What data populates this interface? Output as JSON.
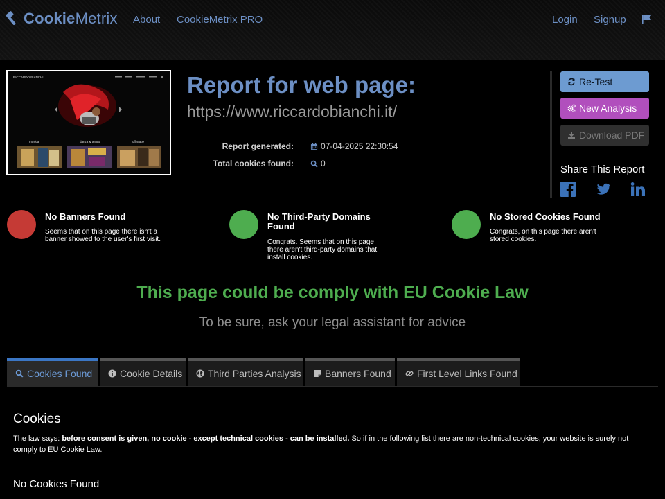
{
  "nav": {
    "brand_bold": "Cookie",
    "brand_rest": "Metrix",
    "about": "About",
    "pro": "CookieMetrix PRO",
    "login": "Login",
    "signup": "Signup"
  },
  "report": {
    "title": "Report for web page:",
    "url": "https://www.riccardobianchi.it/",
    "generated_label": "Report generated:",
    "generated_value": "07-04-2025 22:30:54",
    "total_label": "Total cookies found:",
    "total_value": "0"
  },
  "thumbnail": {
    "site_name": "RICCARDO BIANCHI",
    "captions": [
      "musica",
      "danza & teatro",
      "off stage"
    ]
  },
  "actions": {
    "retest": "Re-Test",
    "new_analysis": "New Analysis",
    "download_pdf": "Download PDF",
    "share_title": "Share This Report"
  },
  "status": [
    {
      "title": "No Banners Found",
      "desc": "Seems that on this page there isn't a banner showed to the user's first visit.",
      "color": "#c53a35"
    },
    {
      "title": "No Third-Party Domains Found",
      "desc": "Congrats. Seems that on this page there aren't third-party domains that install cookies.",
      "color": "#4ead4f"
    },
    {
      "title": "No Stored Cookies Found",
      "desc": "Congrats, on this page there aren't stored cookies.",
      "color": "#4ead4f"
    }
  ],
  "compliance": {
    "message": "This page could be comply with EU Cookie Law",
    "advice": "To be sure, ask your legal assistant for advice"
  },
  "tabs": [
    {
      "label": "Cookies Found",
      "icon": "search-icon",
      "active": true
    },
    {
      "label": "Cookie Details",
      "icon": "info-icon",
      "active": false
    },
    {
      "label": "Third Parties Analysis",
      "icon": "globe-icon",
      "active": false
    },
    {
      "label": "Banners Found",
      "icon": "banner-icon",
      "active": false
    },
    {
      "label": "First Level Links Found",
      "icon": "link-icon",
      "active": false
    }
  ],
  "cookies_section": {
    "title": "Cookies",
    "law_prefix": "The law says: ",
    "law_bold": "before consent is given, no cookie - except technical cookies - can be installed.",
    "law_suffix": " So if in the following list there are non-technical cookies, your website is surely not comply to EU Cookie Law.",
    "empty_message": "No Cookies Found"
  },
  "colors": {
    "brand": "#6c8fc4",
    "retest": "#6d9bd1",
    "new_analysis": "#b14fbd",
    "comply_green": "#4ead4f",
    "banner_red": "#c53a35"
  }
}
